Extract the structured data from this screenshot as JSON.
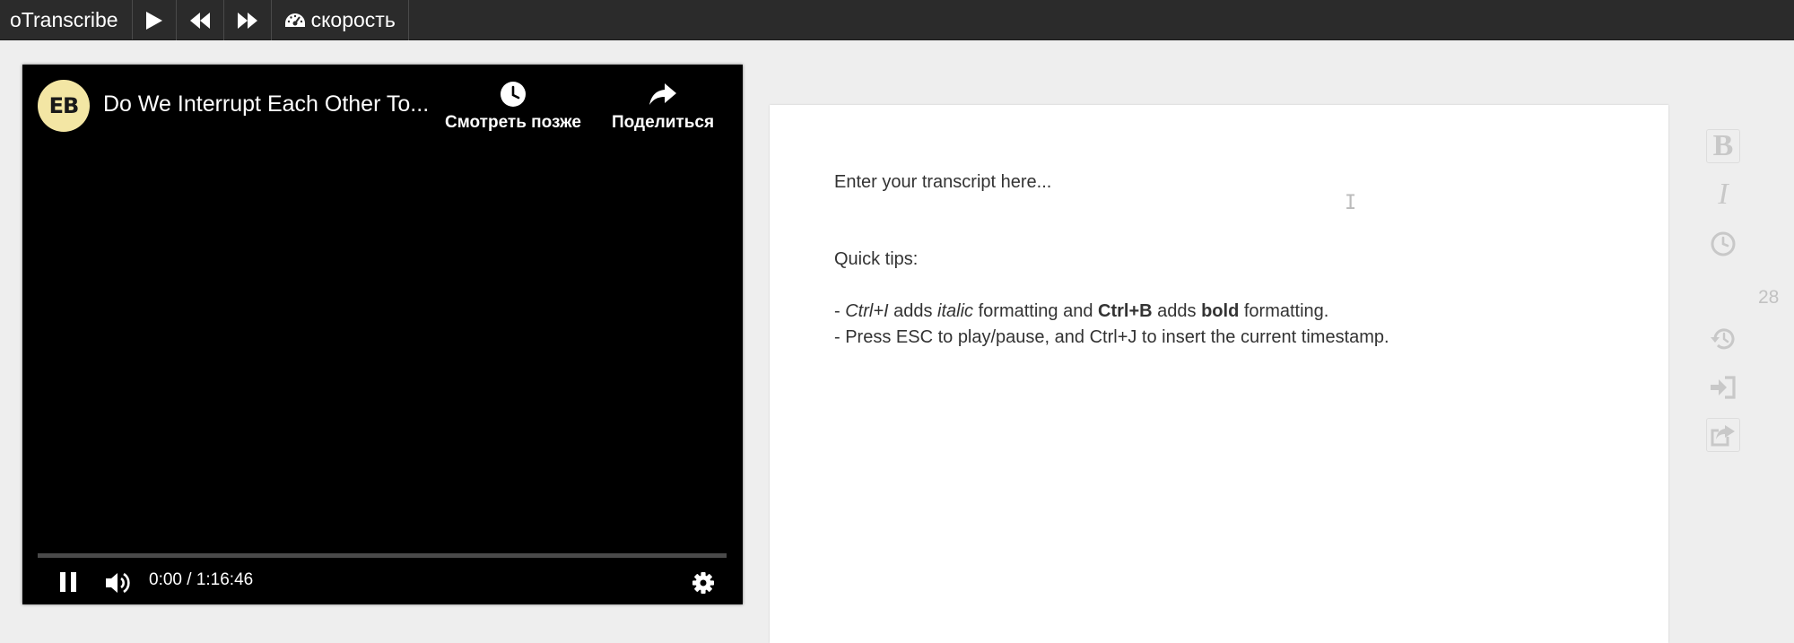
{
  "toolbar": {
    "brand": "oTranscribe",
    "speed_label": "скорость",
    "icons": [
      "play-icon",
      "rewind-icon",
      "fast-forward-icon",
      "speedometer-icon"
    ]
  },
  "player": {
    "channel_avatar_text": "EB",
    "title": "Do We Interrupt Each Other To...",
    "watch_later_label": "Смотреть позже",
    "share_label": "Поделиться",
    "time": "0:00 / 1:16:46",
    "progress": 0
  },
  "editor": {
    "placeholder_line": "Enter your transcript here...",
    "tips_heading": "Quick tips:",
    "tip1": {
      "prefix": "- ",
      "shortcut_italic": "Ctrl+I",
      "text1": " adds ",
      "italic_word": "italic",
      "text2": " formatting and ",
      "shortcut_bold": "Ctrl+B",
      "text3": " adds ",
      "bold_word": "bold",
      "text4": " formatting."
    },
    "tip2": "- Press ESC to play/pause, and Ctrl+J to insert the current timestamp."
  },
  "sidebar": {
    "bold_label": "B",
    "italic_label": "I",
    "word_count": "28"
  },
  "colors": {
    "toolbar_bg": "#2b2b2b",
    "page_bg": "#eeeeee",
    "player_bg": "#000000",
    "disabled_icon": "#c8c8c8"
  }
}
